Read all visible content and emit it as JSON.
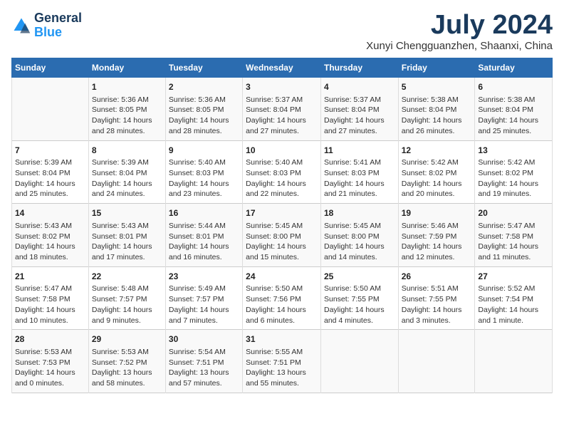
{
  "logo": {
    "line1": "General",
    "line2": "Blue"
  },
  "title": "July 2024",
  "subtitle": "Xunyi Chengguanzhen, Shaanxi, China",
  "weekdays": [
    "Sunday",
    "Monday",
    "Tuesday",
    "Wednesday",
    "Thursday",
    "Friday",
    "Saturday"
  ],
  "weeks": [
    [
      {
        "day": "",
        "info": ""
      },
      {
        "day": "1",
        "info": "Sunrise: 5:36 AM\nSunset: 8:05 PM\nDaylight: 14 hours\nand 28 minutes."
      },
      {
        "day": "2",
        "info": "Sunrise: 5:36 AM\nSunset: 8:05 PM\nDaylight: 14 hours\nand 28 minutes."
      },
      {
        "day": "3",
        "info": "Sunrise: 5:37 AM\nSunset: 8:04 PM\nDaylight: 14 hours\nand 27 minutes."
      },
      {
        "day": "4",
        "info": "Sunrise: 5:37 AM\nSunset: 8:04 PM\nDaylight: 14 hours\nand 27 minutes."
      },
      {
        "day": "5",
        "info": "Sunrise: 5:38 AM\nSunset: 8:04 PM\nDaylight: 14 hours\nand 26 minutes."
      },
      {
        "day": "6",
        "info": "Sunrise: 5:38 AM\nSunset: 8:04 PM\nDaylight: 14 hours\nand 25 minutes."
      }
    ],
    [
      {
        "day": "7",
        "info": "Sunrise: 5:39 AM\nSunset: 8:04 PM\nDaylight: 14 hours\nand 25 minutes."
      },
      {
        "day": "8",
        "info": "Sunrise: 5:39 AM\nSunset: 8:04 PM\nDaylight: 14 hours\nand 24 minutes."
      },
      {
        "day": "9",
        "info": "Sunrise: 5:40 AM\nSunset: 8:03 PM\nDaylight: 14 hours\nand 23 minutes."
      },
      {
        "day": "10",
        "info": "Sunrise: 5:40 AM\nSunset: 8:03 PM\nDaylight: 14 hours\nand 22 minutes."
      },
      {
        "day": "11",
        "info": "Sunrise: 5:41 AM\nSunset: 8:03 PM\nDaylight: 14 hours\nand 21 minutes."
      },
      {
        "day": "12",
        "info": "Sunrise: 5:42 AM\nSunset: 8:02 PM\nDaylight: 14 hours\nand 20 minutes."
      },
      {
        "day": "13",
        "info": "Sunrise: 5:42 AM\nSunset: 8:02 PM\nDaylight: 14 hours\nand 19 minutes."
      }
    ],
    [
      {
        "day": "14",
        "info": "Sunrise: 5:43 AM\nSunset: 8:02 PM\nDaylight: 14 hours\nand 18 minutes."
      },
      {
        "day": "15",
        "info": "Sunrise: 5:43 AM\nSunset: 8:01 PM\nDaylight: 14 hours\nand 17 minutes."
      },
      {
        "day": "16",
        "info": "Sunrise: 5:44 AM\nSunset: 8:01 PM\nDaylight: 14 hours\nand 16 minutes."
      },
      {
        "day": "17",
        "info": "Sunrise: 5:45 AM\nSunset: 8:00 PM\nDaylight: 14 hours\nand 15 minutes."
      },
      {
        "day": "18",
        "info": "Sunrise: 5:45 AM\nSunset: 8:00 PM\nDaylight: 14 hours\nand 14 minutes."
      },
      {
        "day": "19",
        "info": "Sunrise: 5:46 AM\nSunset: 7:59 PM\nDaylight: 14 hours\nand 12 minutes."
      },
      {
        "day": "20",
        "info": "Sunrise: 5:47 AM\nSunset: 7:58 PM\nDaylight: 14 hours\nand 11 minutes."
      }
    ],
    [
      {
        "day": "21",
        "info": "Sunrise: 5:47 AM\nSunset: 7:58 PM\nDaylight: 14 hours\nand 10 minutes."
      },
      {
        "day": "22",
        "info": "Sunrise: 5:48 AM\nSunset: 7:57 PM\nDaylight: 14 hours\nand 9 minutes."
      },
      {
        "day": "23",
        "info": "Sunrise: 5:49 AM\nSunset: 7:57 PM\nDaylight: 14 hours\nand 7 minutes."
      },
      {
        "day": "24",
        "info": "Sunrise: 5:50 AM\nSunset: 7:56 PM\nDaylight: 14 hours\nand 6 minutes."
      },
      {
        "day": "25",
        "info": "Sunrise: 5:50 AM\nSunset: 7:55 PM\nDaylight: 14 hours\nand 4 minutes."
      },
      {
        "day": "26",
        "info": "Sunrise: 5:51 AM\nSunset: 7:55 PM\nDaylight: 14 hours\nand 3 minutes."
      },
      {
        "day": "27",
        "info": "Sunrise: 5:52 AM\nSunset: 7:54 PM\nDaylight: 14 hours\nand 1 minute."
      }
    ],
    [
      {
        "day": "28",
        "info": "Sunrise: 5:53 AM\nSunset: 7:53 PM\nDaylight: 14 hours\nand 0 minutes."
      },
      {
        "day": "29",
        "info": "Sunrise: 5:53 AM\nSunset: 7:52 PM\nDaylight: 13 hours\nand 58 minutes."
      },
      {
        "day": "30",
        "info": "Sunrise: 5:54 AM\nSunset: 7:51 PM\nDaylight: 13 hours\nand 57 minutes."
      },
      {
        "day": "31",
        "info": "Sunrise: 5:55 AM\nSunset: 7:51 PM\nDaylight: 13 hours\nand 55 minutes."
      },
      {
        "day": "",
        "info": ""
      },
      {
        "day": "",
        "info": ""
      },
      {
        "day": "",
        "info": ""
      }
    ]
  ]
}
